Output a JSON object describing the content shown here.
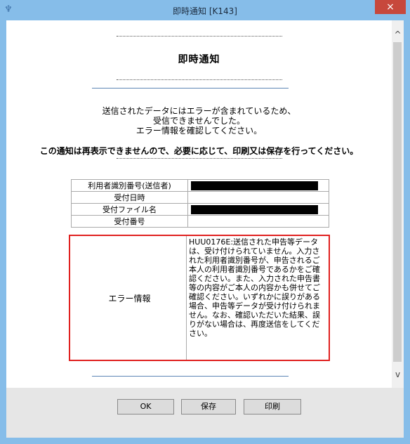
{
  "window": {
    "title": "即時通知 [K143]",
    "close_glyph": "×",
    "icon": "app-icon"
  },
  "notice": {
    "heading": "即時通知",
    "message_lines": [
      "送信されたデータにはエラーが含まれているため、",
      "受信できませんでした。",
      "エラー情報を確認してください。"
    ],
    "wide_message": "この通知は再表示できませんので、必要に応じて、印刷又は保存を行ってください。"
  },
  "table": {
    "rows": [
      {
        "label": "利用者識別番号(送信者)",
        "value_redacted": true
      },
      {
        "label": "受付日時",
        "value": ""
      },
      {
        "label": "受付ファイル名",
        "value_redacted": true
      },
      {
        "label": "受付番号",
        "value": ""
      }
    ],
    "error": {
      "label": "エラー情報",
      "text": "HUU0176E:送信された申告等データは、受け付けられていません。入力された利用者識別番号が、申告されるご本人の利用者識別番号であるかをご確認ください。また、入力された申告書等の内容がご本人の内容かも併せてご確認ください。いずれかに誤りがある場合、申告等データが受け付けられません。なお、確認いただいた結果、誤りがない場合は、再度送信をしてください。"
    }
  },
  "buttons": {
    "ok": "OK",
    "save": "保存",
    "print": "印刷"
  },
  "scrollbar": {
    "up_glyph": "^",
    "down_glyph": "v"
  }
}
